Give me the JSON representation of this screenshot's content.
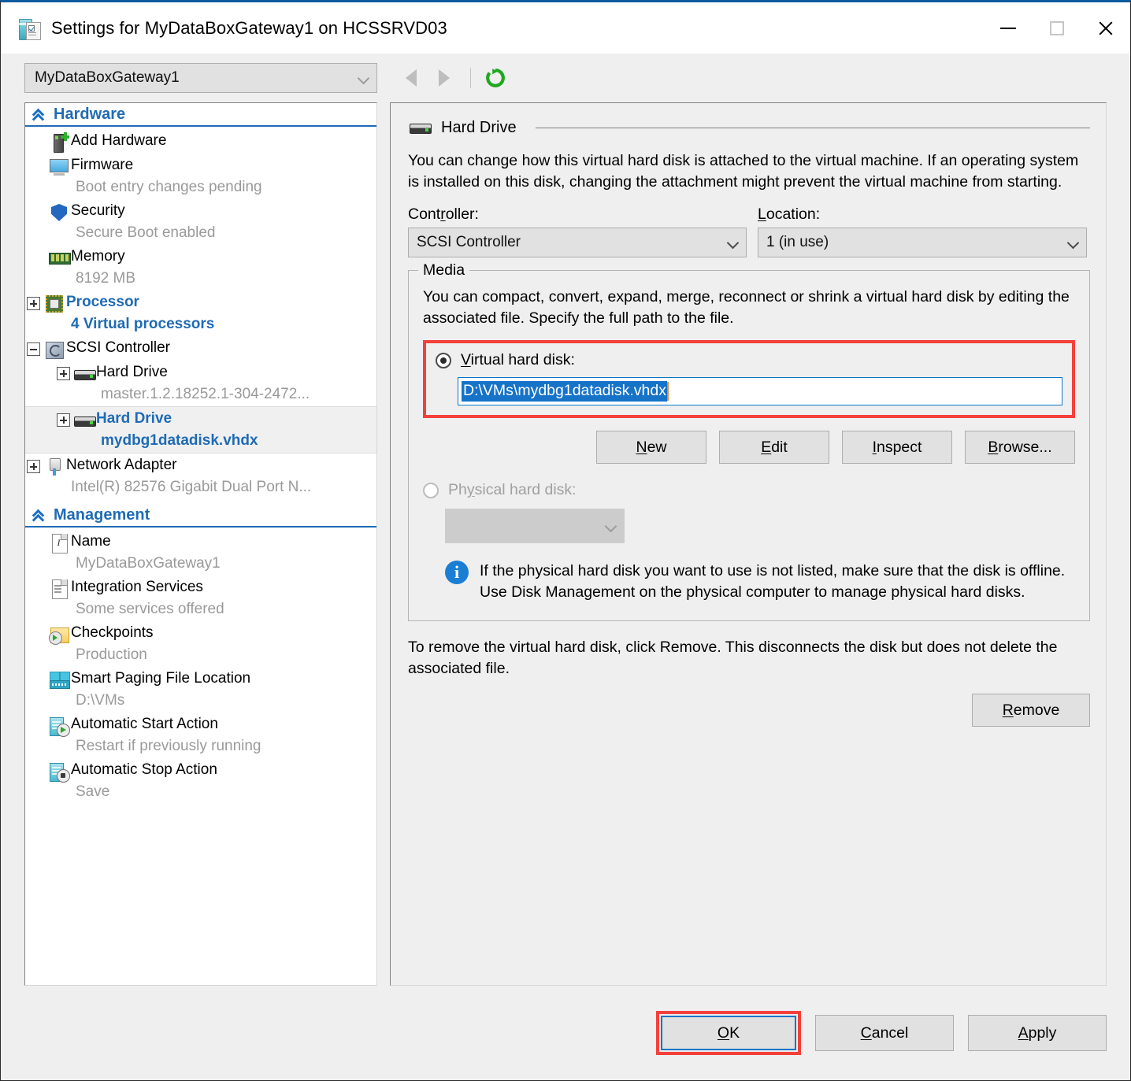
{
  "window": {
    "title": "Settings for MyDataBoxGateway1 on HCSSRVD03",
    "icon": "settings-vm-icon",
    "controls": {
      "minimize": "minimize-icon",
      "maximize": "maximize-icon",
      "close": "close-icon"
    }
  },
  "toolbar": {
    "vm_selector_value": "MyDataBoxGateway1",
    "back": "back-arrow-icon",
    "forward": "forward-arrow-icon",
    "refresh": "refresh-icon"
  },
  "sidebar": {
    "sections": [
      {
        "title": "Hardware",
        "items": [
          {
            "label": "Add Hardware",
            "sub": "",
            "icon": "add-hardware-icon",
            "expander": "none",
            "indent": 1,
            "selected": false,
            "link": false
          },
          {
            "label": "Firmware",
            "sub": "Boot entry changes pending",
            "icon": "firmware-icon",
            "expander": "none",
            "indent": 1,
            "selected": false,
            "link": false
          },
          {
            "label": "Security",
            "sub": "Secure Boot enabled",
            "icon": "security-shield-icon",
            "expander": "none",
            "indent": 1,
            "selected": false,
            "link": false
          },
          {
            "label": "Memory",
            "sub": "8192 MB",
            "icon": "memory-icon",
            "expander": "none",
            "indent": 1,
            "selected": false,
            "link": false
          },
          {
            "label": "Processor",
            "sub": "4 Virtual processors",
            "icon": "processor-icon",
            "expander": "plus",
            "indent": 0,
            "selected": false,
            "link": true
          },
          {
            "label": "SCSI Controller",
            "sub": "",
            "icon": "scsi-controller-icon",
            "expander": "minus",
            "indent": 0,
            "selected": false,
            "link": false
          },
          {
            "label": "Hard Drive",
            "sub": "master.1.2.18252.1-304-2472...",
            "icon": "hard-drive-icon",
            "expander": "plus",
            "indent": 2,
            "selected": false,
            "link": false
          },
          {
            "label": "Hard Drive",
            "sub": "mydbg1datadisk.vhdx",
            "icon": "hard-drive-icon",
            "expander": "plus",
            "indent": 2,
            "selected": true,
            "link": true
          },
          {
            "label": "Network Adapter",
            "sub": "Intel(R) 82576 Gigabit Dual Port N...",
            "icon": "network-adapter-icon",
            "expander": "plus",
            "indent": 0,
            "selected": false,
            "link": false
          }
        ]
      },
      {
        "title": "Management",
        "items": [
          {
            "label": "Name",
            "sub": "MyDataBoxGateway1",
            "icon": "name-document-icon",
            "expander": "none",
            "indent": 1,
            "selected": false,
            "link": false
          },
          {
            "label": "Integration Services",
            "sub": "Some services offered",
            "icon": "integration-services-icon",
            "expander": "none",
            "indent": 1,
            "selected": false,
            "link": false
          },
          {
            "label": "Checkpoints",
            "sub": "Production",
            "icon": "checkpoints-icon",
            "expander": "none",
            "indent": 1,
            "selected": false,
            "link": false
          },
          {
            "label": "Smart Paging File Location",
            "sub": "D:\\VMs",
            "icon": "smart-paging-icon",
            "expander": "none",
            "indent": 1,
            "selected": false,
            "link": false
          },
          {
            "label": "Automatic Start Action",
            "sub": "Restart if previously running",
            "icon": "automatic-start-icon",
            "expander": "none",
            "indent": 1,
            "selected": false,
            "link": false
          },
          {
            "label": "Automatic Stop Action",
            "sub": "Save",
            "icon": "automatic-stop-icon",
            "expander": "none",
            "indent": 1,
            "selected": false,
            "link": false
          }
        ]
      }
    ]
  },
  "panel": {
    "heading": "Hard Drive",
    "heading_icon": "hard-drive-icon",
    "description": "You can change how this virtual hard disk is attached to the virtual machine. If an operating system is installed on this disk, changing the attachment might prevent the virtual machine from starting.",
    "controller": {
      "label_pre": "Cont",
      "label_accel": "r",
      "label_post": "oller:",
      "value": "SCSI Controller"
    },
    "location": {
      "label_accel": "L",
      "label_post": "ocation:",
      "value": "1 (in use)"
    },
    "media": {
      "legend": "Media",
      "description": "You can compact, convert, expand, merge, reconnect or shrink a virtual hard disk by editing the associated file. Specify the full path to the file.",
      "virtual_disk": {
        "accel": "V",
        "label_post": "irtual hard disk:",
        "selected": true,
        "path_value": "D:\\VMs\\mydbg1datadisk.vhdx"
      },
      "buttons": [
        {
          "accel": "N",
          "rest": "ew"
        },
        {
          "accel": "E",
          "rest": "dit"
        },
        {
          "accel": "I",
          "rest": "nspect"
        },
        {
          "accel": "B",
          "rest": "rowse..."
        }
      ],
      "physical_disk": {
        "label_pre": "Ph",
        "accel": "y",
        "label_post": "sical hard disk:",
        "selected": false,
        "value": ""
      },
      "info": "If the physical hard disk you want to use is not listed, make sure that the disk is offline. Use Disk Management on the physical computer to manage physical hard disks.",
      "info_icon": "info-icon"
    },
    "remove_note": "To remove the virtual hard disk, click Remove. This disconnects the disk but does not delete the associated file.",
    "remove_button": {
      "accel": "R",
      "rest": "emove"
    }
  },
  "footer": {
    "ok": {
      "accel": "O",
      "rest": "K"
    },
    "cancel": {
      "accel": "C",
      "rest": "ancel"
    },
    "apply": {
      "accel": "A",
      "rest": "pply"
    }
  },
  "colors": {
    "accent_blue": "#1f6bb5",
    "annotation_red": "#f4403a",
    "selection_blue": "#1673c8",
    "refresh_green": "#1fa81f"
  }
}
